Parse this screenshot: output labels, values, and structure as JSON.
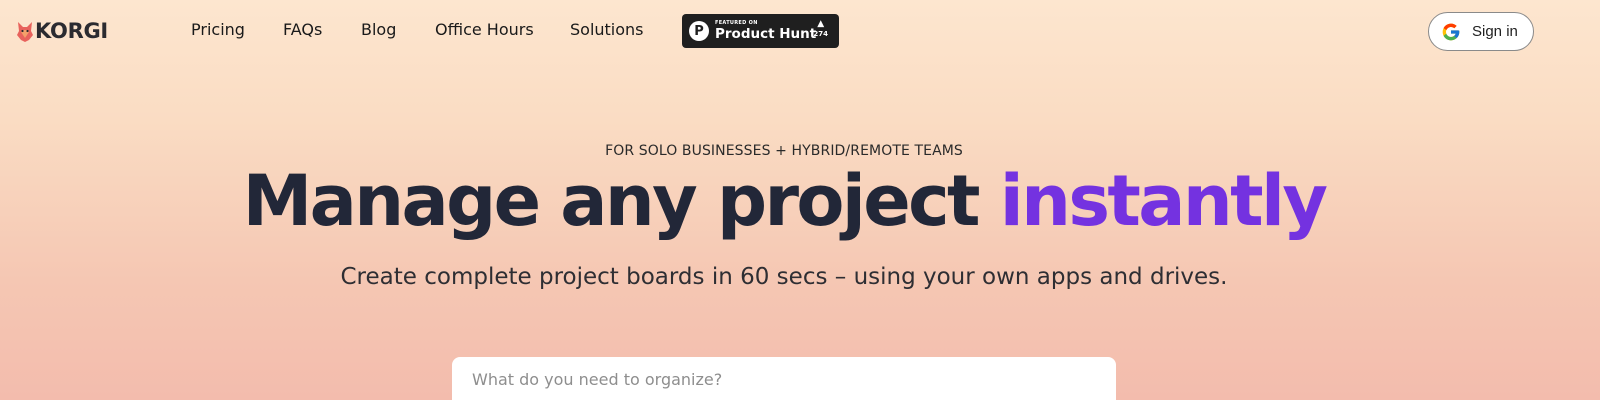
{
  "brand": {
    "name": "KORGI",
    "logo_icon": "korgi-mascot-icon",
    "logo_color": "#e85d5d"
  },
  "nav": {
    "links": [
      {
        "label": "Pricing"
      },
      {
        "label": "FAQs"
      },
      {
        "label": "Blog"
      },
      {
        "label": "Office Hours"
      },
      {
        "label": "Solutions"
      }
    ],
    "product_hunt": {
      "icon": "product-hunt-p-icon",
      "small_label": "FEATURED ON",
      "big_label": "Product Hunt",
      "upvote_icon": "upvote-triangle-icon",
      "votes": "274"
    },
    "sign_in": {
      "icon": "google-g-icon",
      "label": "Sign in"
    }
  },
  "hero": {
    "eyebrow": "FOR SOLO BUSINESSES + HYBRID/REMOTE TEAMS",
    "headline_main": "Manage any project ",
    "headline_accent": "instantly",
    "accent_color": "#7432e0",
    "subhead": "Create complete project boards in 60 secs – using your own apps and drives."
  },
  "search": {
    "placeholder": "What do you need to organize?",
    "value": ""
  }
}
